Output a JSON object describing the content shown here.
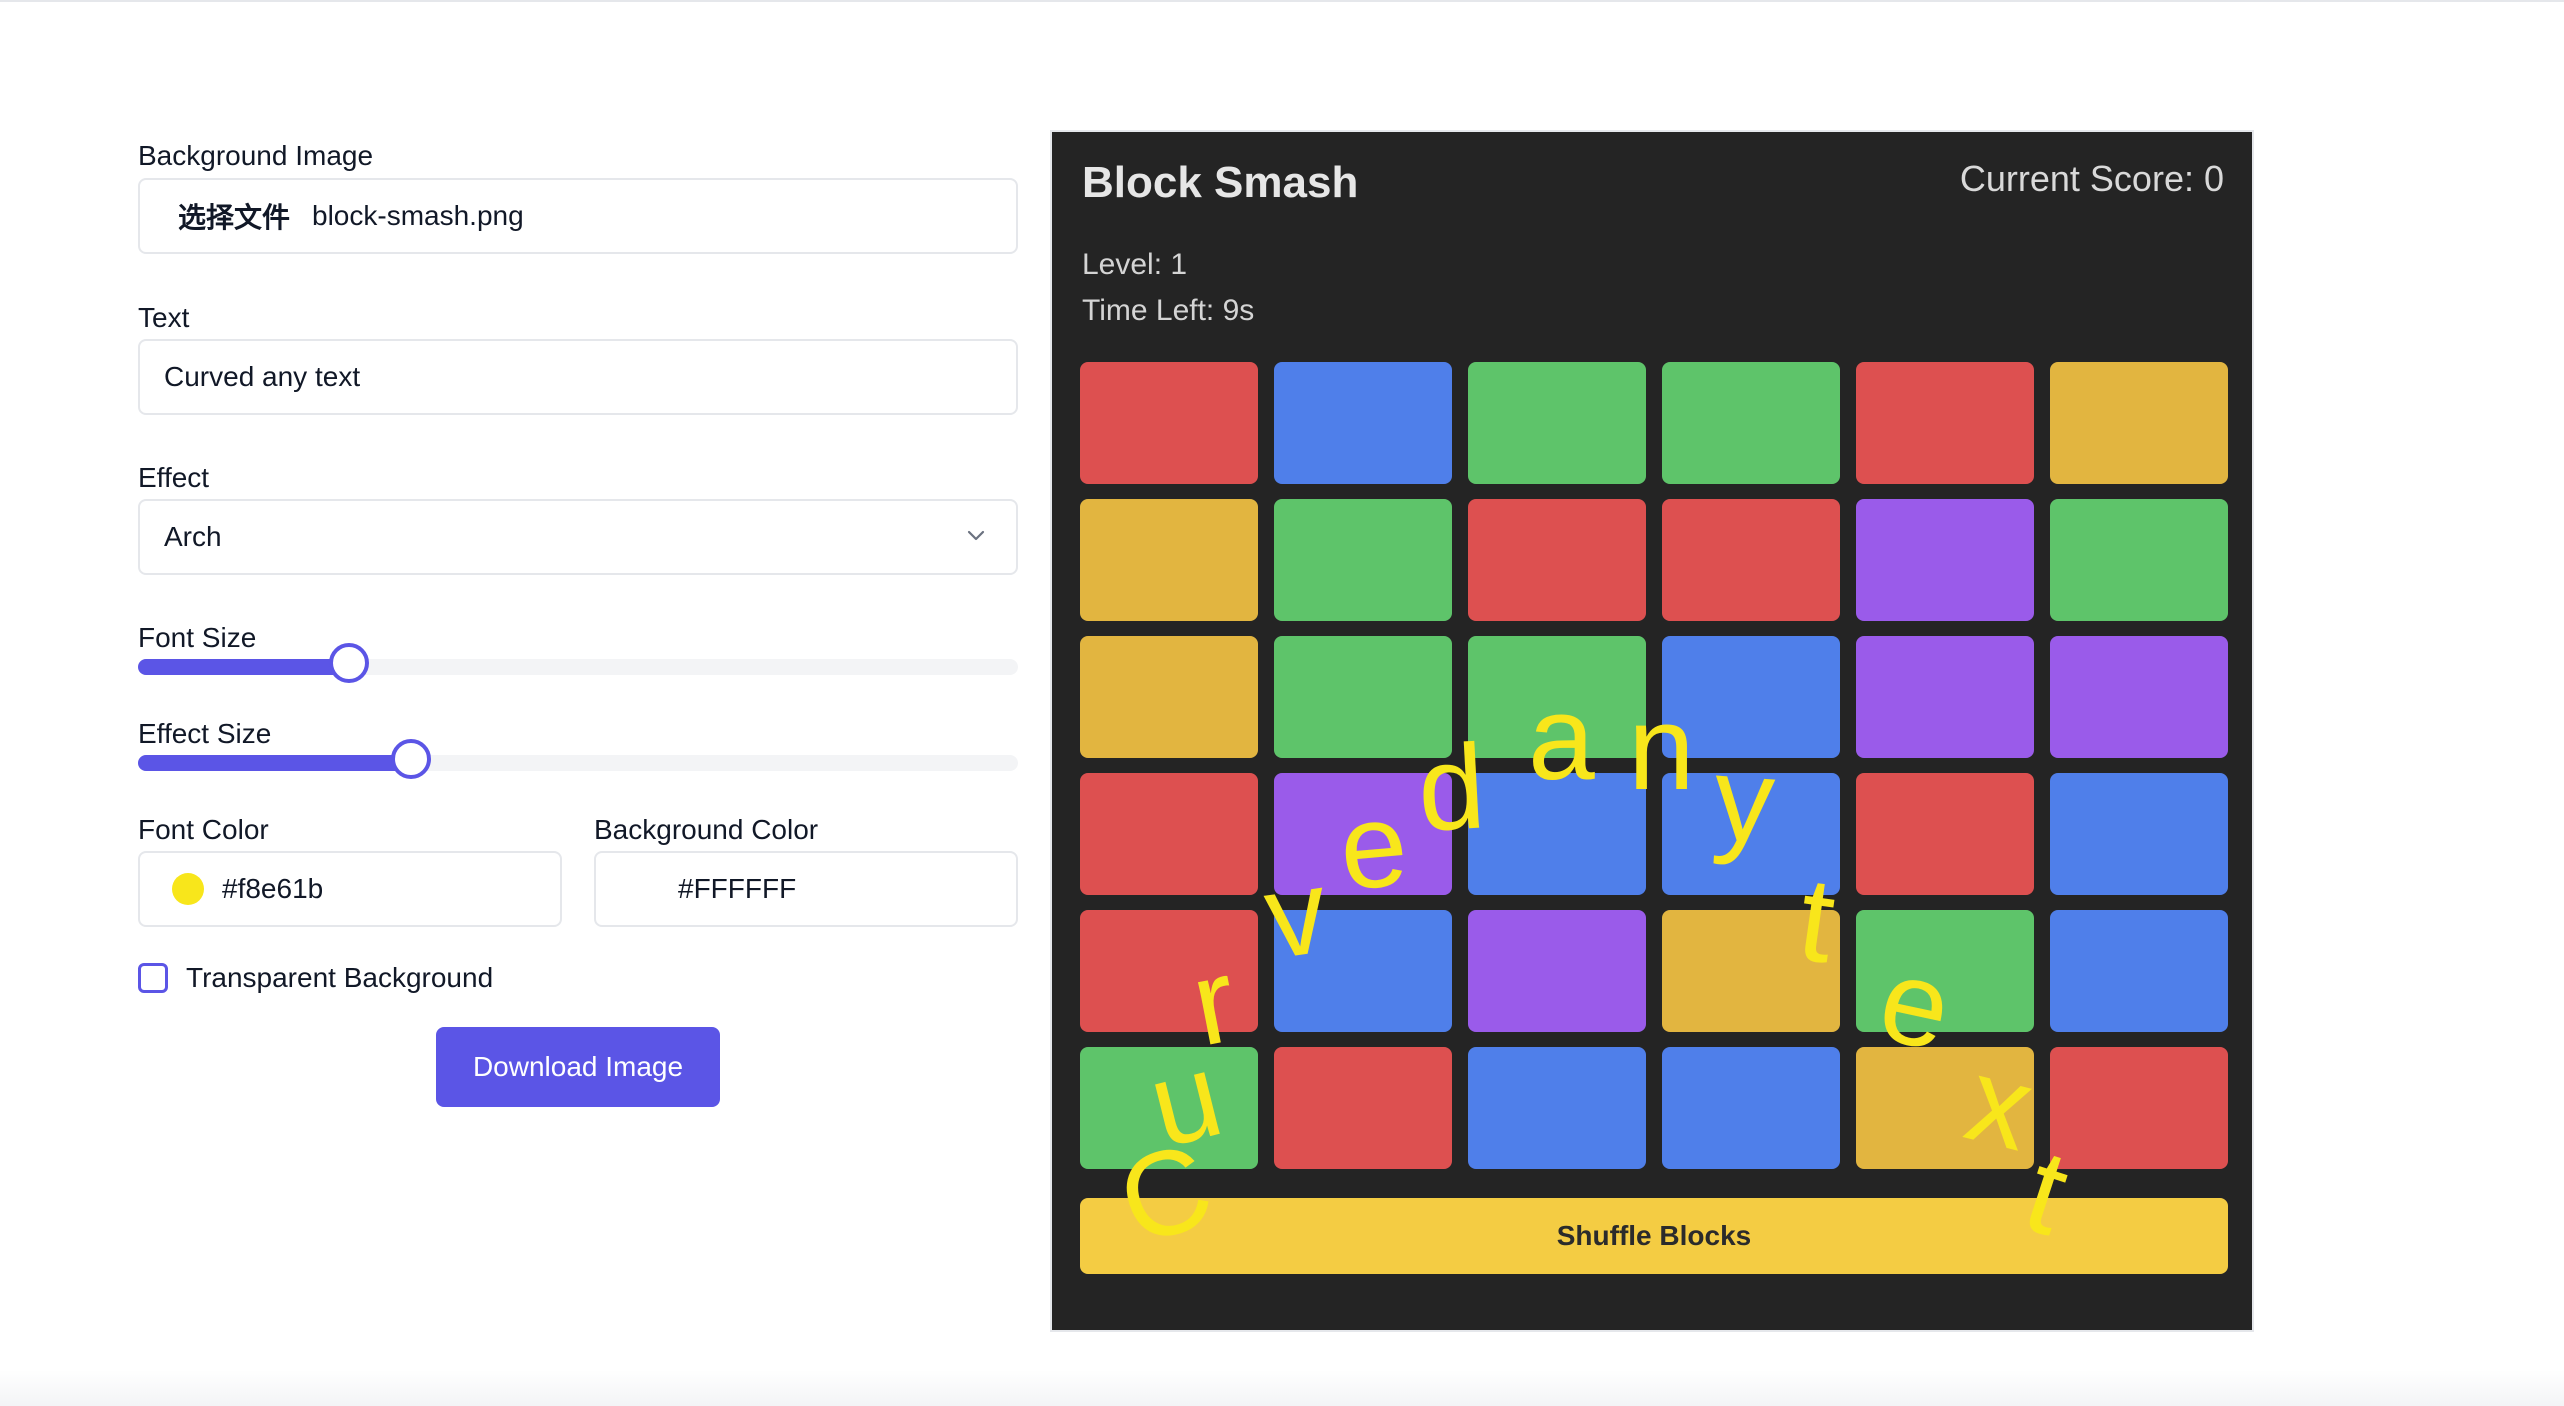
{
  "form": {
    "background_image": {
      "label": "Background Image",
      "button_label": "选择文件",
      "file_name": "block-smash.png"
    },
    "text": {
      "label": "Text",
      "value": "Curved any text"
    },
    "effect": {
      "label": "Effect",
      "selected": "Arch"
    },
    "font_size": {
      "label": "Font Size",
      "value_fraction": 0.24
    },
    "effect_size": {
      "label": "Effect Size",
      "value_fraction": 0.31
    },
    "font_color": {
      "label": "Font Color",
      "value": "#f8e61b"
    },
    "background_color": {
      "label": "Background Color",
      "value": "#FFFFFF"
    },
    "transparent_background": {
      "label": "Transparent Background",
      "checked": false
    },
    "download_label": "Download Image"
  },
  "preview": {
    "title": "Block Smash",
    "score": "Current Score: 0",
    "level": "Level: 1",
    "time_left": "Time Left: 9s",
    "shuffle_label": "Shuffle Blocks",
    "colors": {
      "red": "#dd5050",
      "blue": "#4f7fea",
      "green": "#5ec46a",
      "yellow": "#e2b540",
      "purple": "#9a5bea"
    },
    "grid": [
      [
        "red",
        "blue",
        "green",
        "green",
        "red",
        "yellow"
      ],
      [
        "yellow",
        "green",
        "red",
        "red",
        "purple",
        "green"
      ],
      [
        "yellow",
        "green",
        "green",
        "blue",
        "purple",
        "purple"
      ],
      [
        "red",
        "purple",
        "blue",
        "blue",
        "red",
        "blue"
      ],
      [
        "red",
        "blue",
        "purple",
        "yellow",
        "green",
        "blue"
      ],
      [
        "green",
        "red",
        "blue",
        "blue",
        "yellow",
        "red"
      ]
    ]
  }
}
